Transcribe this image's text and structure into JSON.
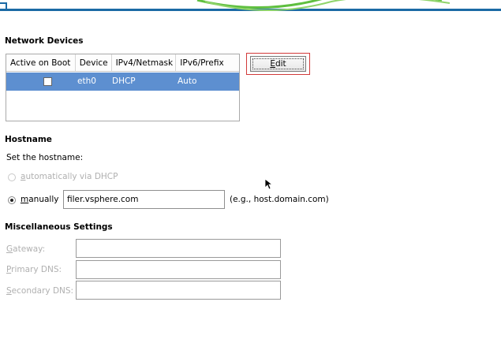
{
  "network_devices": {
    "title": "Network Devices",
    "columns": [
      "Active on Boot",
      "Device",
      "IPv4/Netmask",
      "IPv6/Prefix"
    ],
    "rows": [
      {
        "active": false,
        "device": "eth0",
        "ipv4": "DHCP",
        "ipv6": "Auto"
      }
    ],
    "edit_button": {
      "pre": "",
      "mnemonic": "E",
      "post": "dit"
    }
  },
  "hostname": {
    "title": "Hostname",
    "instruction": "Set the hostname:",
    "auto_option": {
      "mnemonic": "a",
      "rest": "utomatically via DHCP"
    },
    "manual_option": {
      "mnemonic": "m",
      "rest": "anually"
    },
    "value": "filer.vsphere.com",
    "example": "(e.g., host.domain.com)"
  },
  "misc": {
    "title": "Miscellaneous Settings",
    "gateway": {
      "mnemonic": "G",
      "rest": "ateway:",
      "value": ""
    },
    "primary_dns": {
      "mnemonic": "P",
      "rest": "rimary DNS:",
      "value": ""
    },
    "secondary_dns": {
      "mnemonic": "S",
      "rest": "econdary DNS:",
      "value": ""
    }
  },
  "colors": {
    "selection": "#5d8fd0",
    "header_rule": "#1b6aa5",
    "focus_frame": "#d23a3a"
  }
}
